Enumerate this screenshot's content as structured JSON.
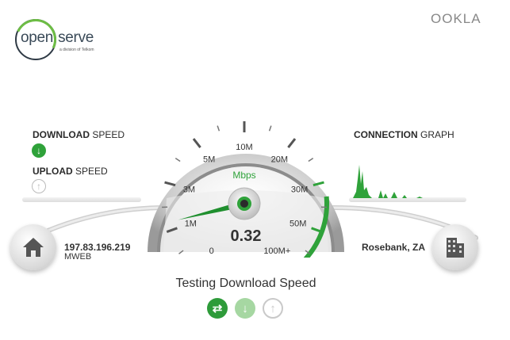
{
  "brand": {
    "logo_word_1": "open",
    "logo_word_2": "serve",
    "logo_tagline": "a division of Telkom",
    "ookla": "OOKLA"
  },
  "download": {
    "bold": "DOWNLOAD",
    "rest": " SPEED"
  },
  "upload": {
    "bold": "UPLOAD",
    "rest": " SPEED"
  },
  "connection_graph": {
    "bold": "CONNECTION",
    "rest": " GRAPH"
  },
  "client": {
    "ip": "197.83.196.219",
    "isp": "MWEB"
  },
  "server": {
    "location": "Rosebank, ZA"
  },
  "gauge": {
    "unit": "Mbps",
    "readout": "0.32",
    "value": 0.32,
    "ticks": [
      {
        "label": "0"
      },
      {
        "label": "1M"
      },
      {
        "label": "3M"
      },
      {
        "label": "5M"
      },
      {
        "label": "10M"
      },
      {
        "label": "20M"
      },
      {
        "label": "30M"
      },
      {
        "label": "50M"
      },
      {
        "label": "100M+"
      }
    ]
  },
  "status": {
    "text": "Testing Download Speed"
  },
  "colors": {
    "accent": "#2fa23a",
    "needle": "#1f8f2e",
    "dark": "#2f3a45"
  },
  "icons": {
    "client": "home-icon",
    "server": "building-icon",
    "download": "arrow-down-icon",
    "upload": "arrow-up-icon",
    "ping": "swap-arrows-icon"
  }
}
